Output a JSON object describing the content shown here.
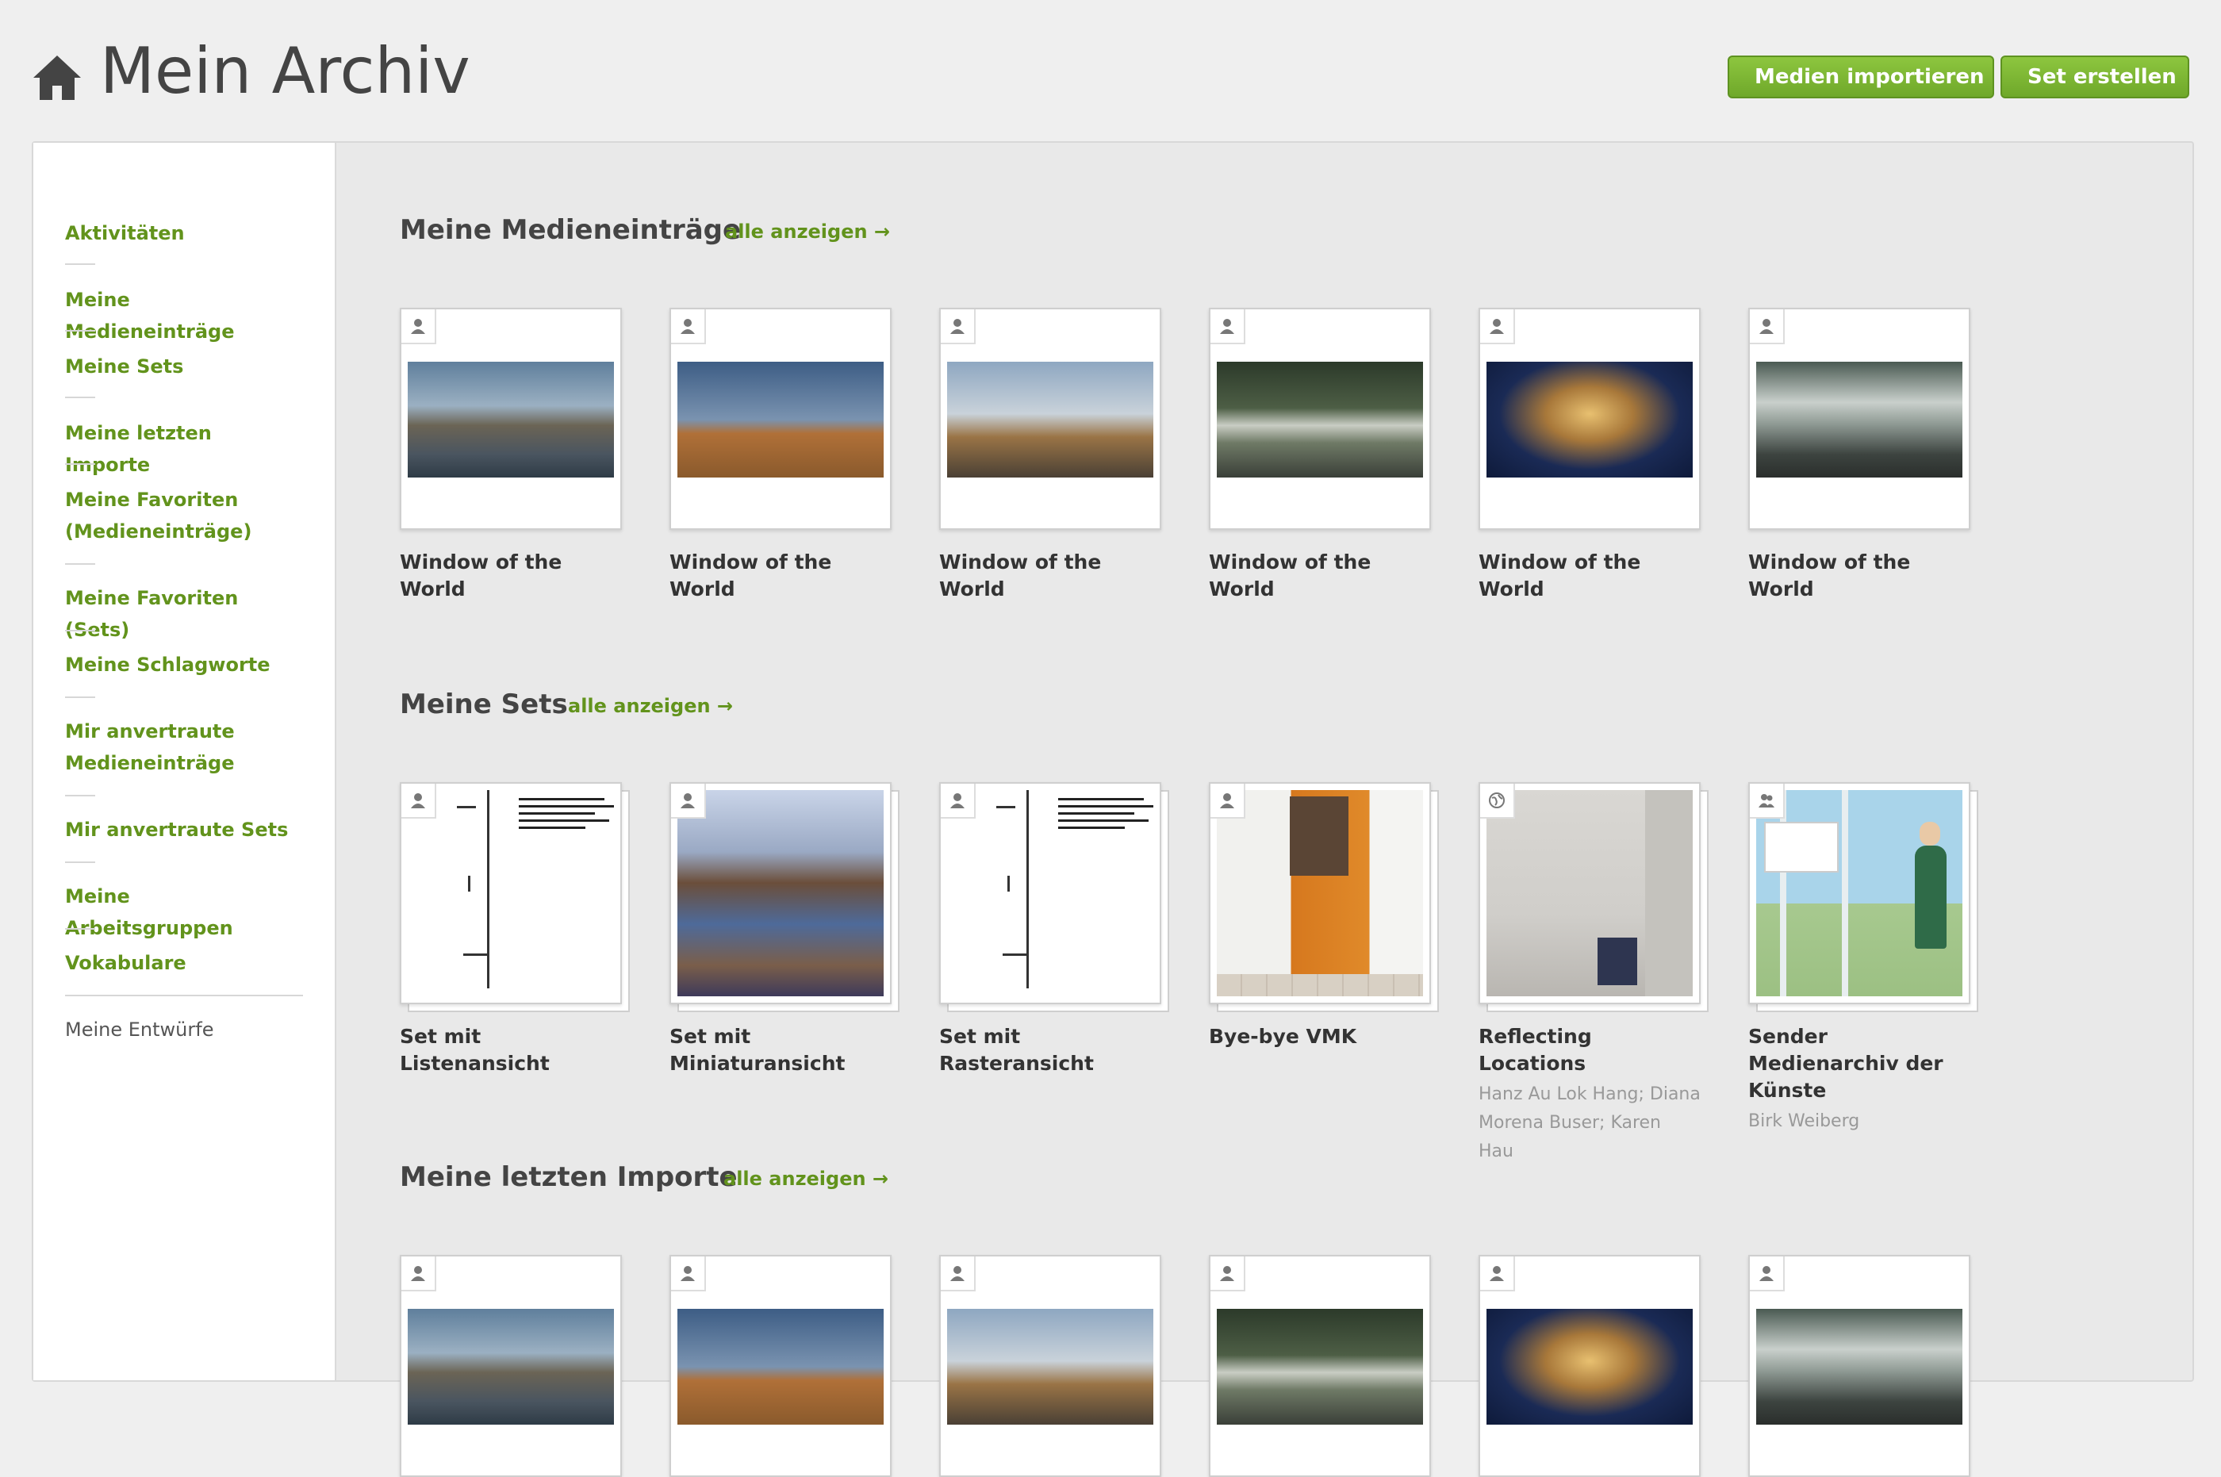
{
  "header": {
    "title": "Mein Archiv",
    "import_label": "Medien importieren",
    "create_set_label": "Set erstellen"
  },
  "colors": {
    "accent": "#6fa82a",
    "nav_link": "#62931c"
  },
  "sidebar": {
    "items": [
      {
        "label": "Aktivitäten"
      },
      {
        "label": "Meine Medieneinträge"
      },
      {
        "label": "Meine Sets"
      },
      {
        "label": "Meine letzten Importe"
      },
      {
        "label": "Meine Favoriten (Medieneinträge)"
      },
      {
        "label": "Meine Favoriten (Sets)"
      },
      {
        "label": "Meine Schlagworte"
      },
      {
        "label": "Mir anvertraute Medieneinträge"
      },
      {
        "label": "Mir anvertraute Sets"
      },
      {
        "label": "Meine Arbeitsgruppen"
      },
      {
        "label": "Vokabulare"
      },
      {
        "label": "Meine Entwürfe"
      }
    ]
  },
  "sections": [
    {
      "title": "Meine Medieneinträge",
      "show_all": "alle anzeigen →",
      "items": [
        {
          "caption": "Window of the World",
          "icon": "user-icon"
        },
        {
          "caption": "Window of the World",
          "icon": "user-icon"
        },
        {
          "caption": "Window of the World",
          "icon": "user-icon"
        },
        {
          "caption": "Window of the World",
          "icon": "user-icon"
        },
        {
          "caption": "Window of the World",
          "icon": "user-icon"
        },
        {
          "caption": "Window of the World",
          "icon": "user-icon"
        }
      ]
    },
    {
      "title": "Meine Sets",
      "show_all": "alle anzeigen →",
      "items": [
        {
          "caption": "Set mit Listenansicht",
          "icon": "user-icon"
        },
        {
          "caption": "Set mit Miniaturansicht",
          "icon": "user-icon"
        },
        {
          "caption": "Set mit Rasteransicht",
          "icon": "user-icon"
        },
        {
          "caption": "Bye-bye VMK",
          "icon": "user-icon"
        },
        {
          "caption": "Reflecting Locations",
          "icon": "globe-icon",
          "meta": "Hanz Au Lok Hang; Diana Morena Buser; Karen Hau"
        },
        {
          "caption": "Sender Medienarchiv der Künste",
          "icon": "group-icon",
          "meta": "Birk Weiberg"
        }
      ]
    },
    {
      "title": "Meine letzten Importe",
      "show_all": "alle anzeigen →",
      "items": [
        {
          "icon": "user-icon"
        },
        {
          "icon": "user-icon"
        },
        {
          "icon": "user-icon"
        },
        {
          "icon": "user-icon"
        },
        {
          "icon": "user-icon"
        },
        {
          "icon": "user-icon"
        }
      ]
    }
  ]
}
